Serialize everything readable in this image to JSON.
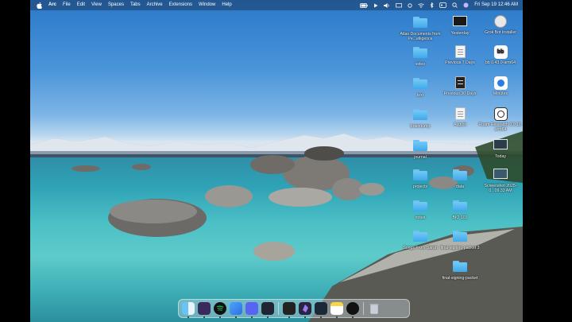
{
  "menubar": {
    "items": [
      "Arc",
      "File",
      "Edit",
      "View",
      "Spaces",
      "Tabs",
      "Archive",
      "Extensions",
      "Window",
      "Help"
    ],
    "datetime": "Fri Sep 19  12:46 AM"
  },
  "desktop_icons": [
    {
      "label": "Atlas Documents from Pe...elligence",
      "icon": "folder-icon"
    },
    {
      "label": "Yesterday",
      "icon": "screenshot-stack-icon"
    },
    {
      "label": "Grok Bot Installer",
      "icon": "disk-image-icon"
    },
    {
      "label": "video",
      "icon": "folder-icon"
    },
    {
      "label": "Previous 7 Days",
      "icon": "document-stack-icon"
    },
    {
      "label": "bb 0.43.0-arm64",
      "icon": "bb-app-icon"
    },
    {
      "label": "text",
      "icon": "folder-icon"
    },
    {
      "label": "Previous 30 Days",
      "icon": "document-stack-icon"
    },
    {
      "label": "Minutes",
      "icon": "minutes-app-icon"
    },
    {
      "label": "braindump",
      "icon": "folder-icon"
    },
    {
      "label": "August",
      "icon": "document-stack-icon"
    },
    {
      "label": "Roam Research 0.0.18-arm64",
      "icon": "roam-app-icon"
    },
    {
      "label": "journal",
      "icon": "folder-icon"
    },
    {
      "label": "Today",
      "icon": "screenshot-stack-icon"
    },
    {
      "label": "projects",
      "icon": "folder-icon"
    },
    {
      "label": "data",
      "icon": "folder-icon"
    },
    {
      "label": "Screenshot 2025-0...09.33 AM",
      "icon": "screenshot-icon"
    },
    {
      "label": "notes",
      "icon": "folder-icon"
    },
    {
      "label": "BIO 101",
      "icon": "folder-icon"
    },
    {
      "label": "Songs From Sarah",
      "icon": "folder-icon"
    },
    {
      "label": "final-signing-packet 3",
      "icon": "folder-icon"
    },
    {
      "label": "final-signing-packet",
      "icon": "folder-icon"
    }
  ],
  "dock": [
    "finder-icon",
    "notion-like-icon",
    "spotify-icon",
    "arc-icon",
    "discord-icon",
    "terminal-icon",
    "cursor-icon",
    "obsidian-icon",
    "sublime-icon",
    "notes-icon",
    "chatgpt-icon",
    "trash-icon"
  ],
  "colors": {
    "accent": "#3fa9ea",
    "menubar": "#1e3c64"
  }
}
